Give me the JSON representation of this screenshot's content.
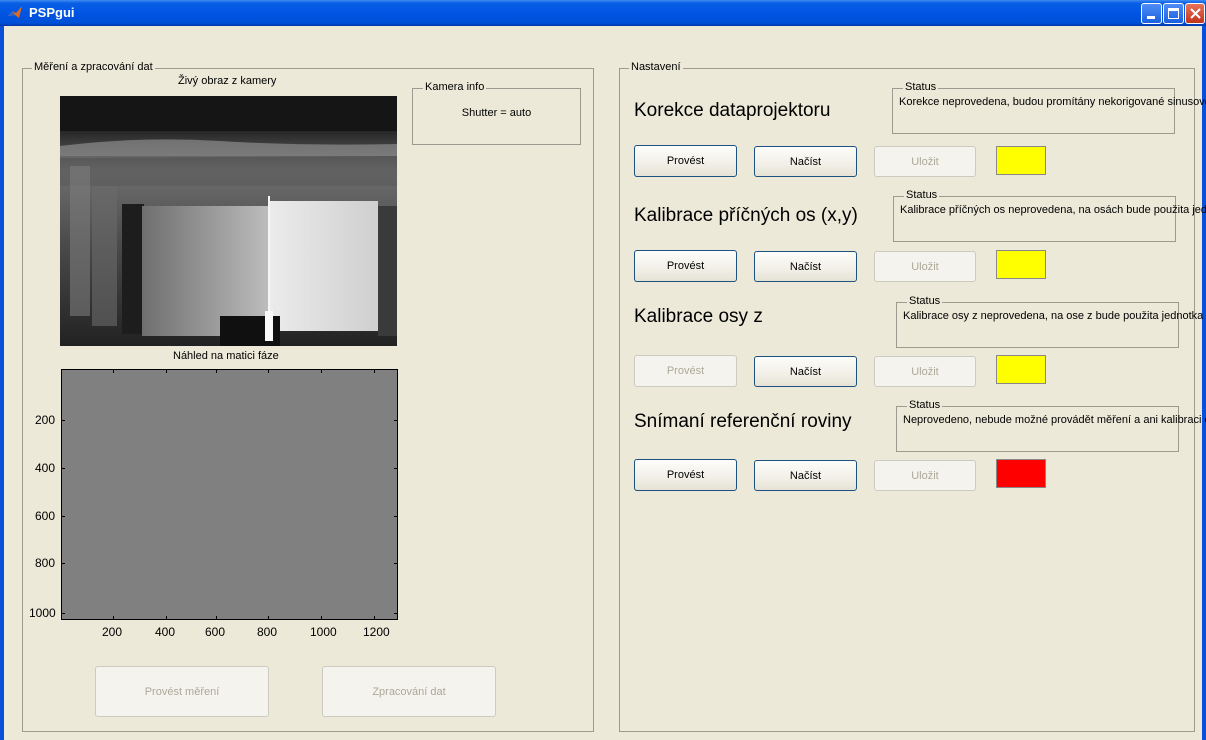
{
  "window": {
    "title": "PSPgui",
    "icons": {
      "app": "matlab-icon",
      "minimize": "minimize-icon",
      "maximize": "maximize-icon",
      "close": "close-icon"
    }
  },
  "measure_panel": {
    "label": "Měření a zpracování dat",
    "camera_title": "Živý obraz z kamery",
    "camera_info": {
      "label": "Kamera info",
      "text": "Shutter = auto"
    },
    "phase_title": "Náhled na matici fáze",
    "phase_axes": {
      "x_ticks": [
        "200",
        "400",
        "600",
        "800",
        "1000",
        "1200"
      ],
      "y_ticks": [
        "200",
        "400",
        "600",
        "800",
        "1000"
      ]
    },
    "buttons": {
      "measure": "Provést měření",
      "process": "Zpracování dat"
    }
  },
  "settings_panel": {
    "label": "Nastavení",
    "sections": [
      {
        "title": "Korekce dataprojektoru",
        "status_label": "Status",
        "status_text": "Korekce neprovedena, budou promítány nekorigované sinusové mřížky",
        "buttons": {
          "run": "Provést",
          "load": "Načíst",
          "save": "Uložit"
        },
        "indicator_color": "#ffff00"
      },
      {
        "title": "Kalibrace příčných os (x,y)",
        "status_label": "Status",
        "status_text": "Kalibrace příčných os neprovedena, na osách bude použita jednotka pixel",
        "buttons": {
          "run": "Provést",
          "load": "Načíst",
          "save": "Uložit"
        },
        "indicator_color": "#ffff00"
      },
      {
        "title": "Kalibrace osy z",
        "status_label": "Status",
        "status_text": "Kalibrace osy z neprovedena, na ose z bude použita jednotka fáze",
        "buttons": {
          "run": "Provést",
          "load": "Načíst",
          "save": "Uložit"
        },
        "indicator_color": "#ffff00"
      },
      {
        "title": "Snímaní referenční roviny",
        "status_label": "Status",
        "status_text": "Neprovedeno, nebude možné provádět měření a ani kalibraci osy z",
        "buttons": {
          "run": "Provést",
          "load": "Načíst",
          "save": "Uložit"
        },
        "indicator_color": "#ff0000"
      }
    ]
  }
}
